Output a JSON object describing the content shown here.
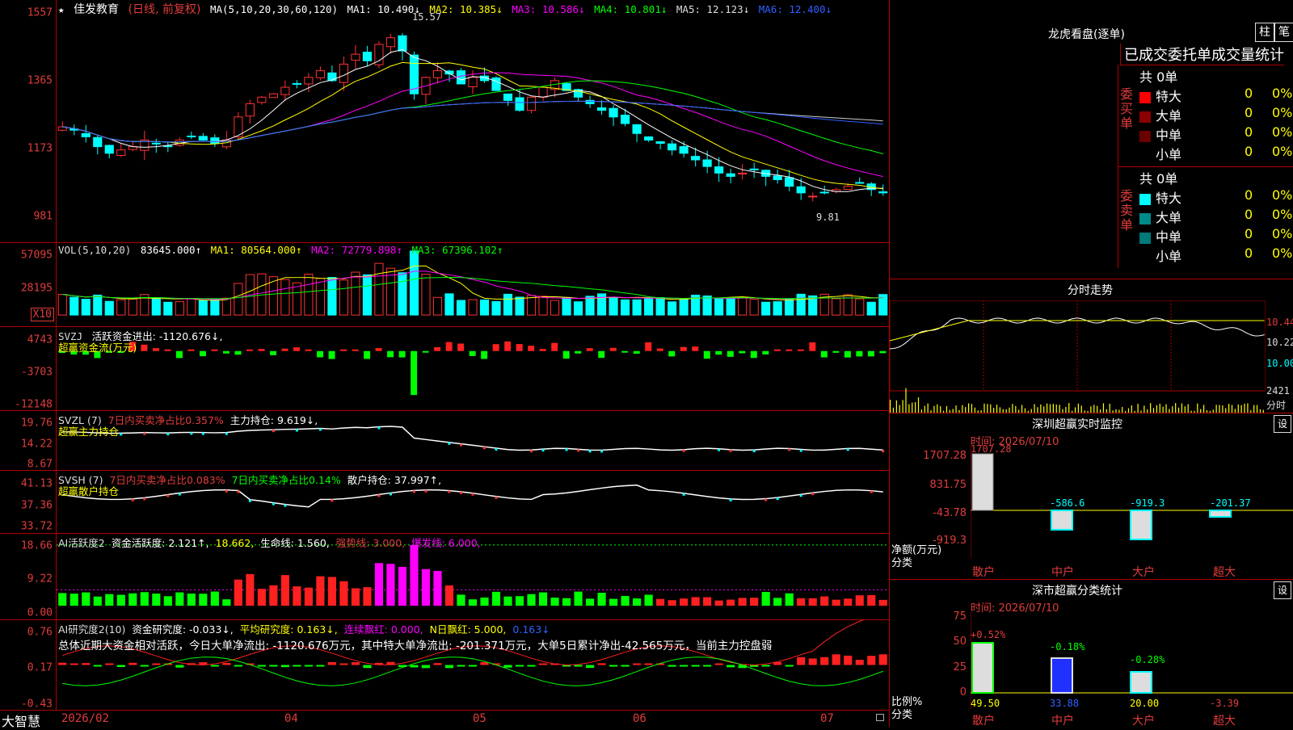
{
  "app": {
    "name": "大智慧"
  },
  "stock": {
    "name": "佳发教育",
    "mode": "(日线, 前复权)"
  },
  "main": {
    "ma_label": "MA(5,10,20,30,60,120)",
    "ma1": "MA1: 10.490↓",
    "ma2": "MA2: 10.385↓",
    "ma3": "MA3: 10.586↓",
    "ma4": "MA4: 10.801↓",
    "ma5": "MA5: 12.123↓",
    "ma6": "MA6: 12.400↓",
    "yticks": [
      "1557",
      "1365",
      "1173",
      "981"
    ],
    "high_mark": "15.57",
    "low_mark": "9.81"
  },
  "vol": {
    "label": "VOL(5,10,20)",
    "v": "83645.000↑",
    "ma1": "MA1: 80564.000↑",
    "ma2": "MA2: 72779.898↑",
    "ma3": "MA3: 67396.102↑",
    "yticks": [
      "57095",
      "28195"
    ],
    "unit": "X10"
  },
  "svzj": {
    "label": "SVZJ",
    "text": "活跃资金进出: -1120.676↓,",
    "sub": "超赢资金流(万元)",
    "yticks": [
      "4743",
      "-3703",
      "-12148"
    ]
  },
  "svzl": {
    "label": "SVZL (7)",
    "t1": "7日内买卖净占比0.357%",
    "t2": "主力持仓: 9.619↓,",
    "sub": "超赢主力持仓",
    "yticks": [
      "19.76",
      "14.22",
      "8.67"
    ]
  },
  "svsh": {
    "label": "SVSH (7)",
    "t1": "7日内买卖净占比0.083%",
    "t2": "7日内买卖净占比0.14%",
    "t3": "散户持仓: 37.997↑,",
    "sub": "超赢散户持仓",
    "yticks": [
      "41.13",
      "37.36",
      "33.72"
    ]
  },
  "aih": {
    "label": "AI活跃度2",
    "t1": "资金活跃度: 2.121↑,",
    "t2": "18.662,",
    "t3": "生命线: 1.560,",
    "t4": "强势线: 3.000,",
    "t5": "爆发线: 6.000,",
    "yticks": [
      "18.66",
      "9.22",
      "0.00"
    ]
  },
  "aiy": {
    "label": "AI研究度2(10)",
    "t1": "资金研究度: -0.033↓,",
    "t2": "平均研究度: 0.163↓,",
    "t3": "连续飘红: 0.000,",
    "t4": "N日飘红: 5.000,",
    "t5": "0.163↓",
    "summary": "总体近期大资金相对活跃，今日大单净流出: -1120.676万元，其中特大单净流出: -201.371万元，大单5日累计净出-42.565万元，当前主力控盘弱",
    "yticks": [
      "0.76",
      "0.17",
      "-0.43"
    ]
  },
  "xaxis": {
    "labels": [
      "2026/02",
      "04",
      "05",
      "06",
      "07"
    ]
  },
  "lhb": {
    "title": "龙虎看盘(逐单)",
    "btn1": "柱",
    "btn2": "笔",
    "subtitle": "已成交委托单成交量统计",
    "buy": {
      "label": "委买单",
      "total": "共 0单",
      "rows": [
        {
          "name": "特大",
          "n": "0",
          "p": "0%"
        },
        {
          "name": "大单",
          "n": "0",
          "p": "0%"
        },
        {
          "name": "中单",
          "n": "0",
          "p": "0%"
        },
        {
          "name": "小单",
          "n": "0",
          "p": "0%"
        }
      ]
    },
    "sell": {
      "label": "委卖单",
      "total": "共 0单",
      "rows": [
        {
          "name": "特大",
          "n": "0",
          "p": "0%"
        },
        {
          "name": "大单",
          "n": "0",
          "p": "0%"
        },
        {
          "name": "中单",
          "n": "0",
          "p": "0%"
        },
        {
          "name": "小单",
          "n": "0",
          "p": "0%"
        }
      ]
    }
  },
  "intraday": {
    "title": "分时走势",
    "p1": "10.44",
    "p2": "10.22",
    "p3": "10.00",
    "vol": "2421",
    "unit": "分时"
  },
  "szmon": {
    "title": "深圳超赢实时监控",
    "btn": "设",
    "time": "时间: 2026/07/10",
    "yticks": [
      "1707.28",
      "831.75",
      "-43.78",
      "-919.3"
    ],
    "ylabel1": "净额(万元)",
    "ylabel2": "分类",
    "cats": [
      "散户",
      "中户",
      "大户",
      "超大"
    ],
    "vals": [
      "1707.28",
      "-586.6",
      "-919.3",
      "-201.37"
    ]
  },
  "szcls": {
    "title": "深市超赢分类统计",
    "btn": "设",
    "time": "时间: 2026/07/10",
    "yticks": [
      "75",
      "50",
      "25",
      "0"
    ],
    "ylabel1": "比例%",
    "ylabel2": "分类",
    "cats": [
      "散户",
      "中户",
      "大户",
      "超大"
    ],
    "top": [
      "+0.52%",
      "-0.18%",
      "-0.28%",
      ""
    ],
    "bottom": [
      "49.50",
      "33.88",
      "20.00",
      "-3.39"
    ]
  },
  "chart_data": {
    "type": "candlestick",
    "title": "佳发教育(日线, 前复权)",
    "ylim": [
      9.0,
      15.8
    ],
    "x_labels": [
      "2026/02",
      "04",
      "05",
      "06",
      "07"
    ],
    "high": 15.57,
    "low": 9.81,
    "close_series": [
      12.3,
      12.2,
      12.0,
      11.7,
      11.5,
      11.6,
      11.7,
      11.9,
      11.8,
      11.7,
      11.9,
      12.0,
      11.9,
      11.8,
      11.9,
      12.6,
      13.0,
      13.2,
      13.3,
      13.5,
      13.6,
      13.8,
      14.0,
      13.7,
      14.2,
      14.5,
      14.3,
      14.8,
      15.0,
      14.6,
      13.3,
      13.8,
      14.0,
      13.9,
      13.6,
      13.8,
      13.7,
      13.4,
      13.1,
      12.8,
      13.2,
      13.5,
      13.7,
      13.4,
      13.2,
      13.0,
      12.8,
      12.6,
      12.4,
      12.1,
      11.9,
      11.8,
      11.6,
      11.5,
      11.3,
      11.1,
      10.9,
      10.8,
      10.9,
      11.0,
      10.8,
      10.7,
      10.5,
      10.3,
      10.2,
      10.3,
      10.4,
      10.5,
      10.6,
      10.4,
      10.3
    ]
  }
}
